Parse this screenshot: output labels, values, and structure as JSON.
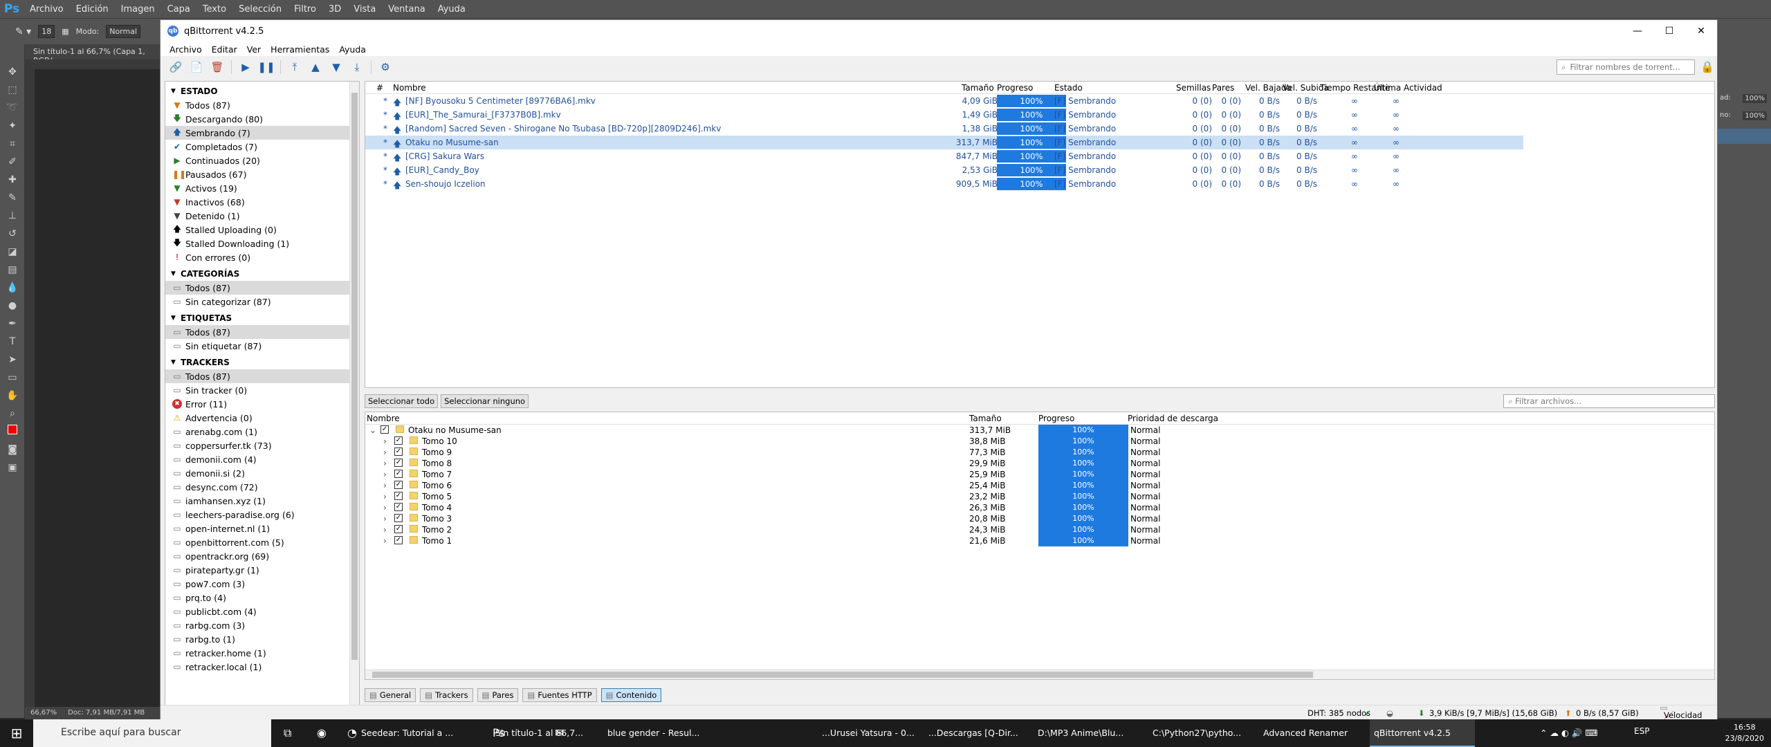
{
  "ps": {
    "menu": [
      "Archivo",
      "Edición",
      "Imagen",
      "Capa",
      "Texto",
      "Selección",
      "Filtro",
      "3D",
      "Vista",
      "Ventana",
      "Ayuda"
    ],
    "brush_size": "18",
    "mode_label": "Modo:",
    "mode_value": "Normal",
    "doc_tab": "Sin título-1 al 66,7% (Capa 1, RGB/",
    "zoom": "66,67%",
    "doc_size": "Doc: 7,91 MB/7,91 MB",
    "right_opacity_label": "ad:",
    "right_opacity": "100%",
    "right_fill_label": "no:",
    "right_fill": "100%"
  },
  "qb": {
    "title": "qBittorrent v4.2.5",
    "menu": [
      "Archivo",
      "Editar",
      "Ver",
      "Herramientas",
      "Ayuda"
    ],
    "search_placeholder": "Filtrar nombres de torrent...",
    "sidebar": {
      "estado_title": "ESTADO",
      "estado": [
        {
          "label": "Todos (87)",
          "icon": "funnel",
          "color": "#d27a1c"
        },
        {
          "label": "Descargando (80)",
          "icon": "down-arrow",
          "color": "#2e7d32"
        },
        {
          "label": "Sembrando (7)",
          "icon": "up-arrow",
          "color": "#1d5fa8",
          "selected": true
        },
        {
          "label": "Completados (7)",
          "icon": "check",
          "color": "#1d5fa8"
        },
        {
          "label": "Continuados (20)",
          "icon": "play",
          "color": "#2e7d32"
        },
        {
          "label": "Pausados (67)",
          "icon": "pause",
          "color": "#d27a1c"
        },
        {
          "label": "Activos (19)",
          "icon": "funnel",
          "color": "#2e7d32"
        },
        {
          "label": "Inactivos (68)",
          "icon": "funnel",
          "color": "#c0392b"
        },
        {
          "label": "Detenido (1)",
          "icon": "funnel",
          "color": "#444"
        },
        {
          "label": "Stalled Uploading (0)",
          "icon": "up-arrow",
          "color": "#000"
        },
        {
          "label": "Stalled Downloading (1)",
          "icon": "down-arrow",
          "color": "#000"
        },
        {
          "label": "Con errores (0)",
          "icon": "exclamation",
          "color": "#c00"
        }
      ],
      "categorias_title": "CATEGORÍAS",
      "categorias": [
        {
          "label": "Todos (87)",
          "selected": true
        },
        {
          "label": "Sin categorizar (87)"
        }
      ],
      "etiquetas_title": "ETIQUETAS",
      "etiquetas": [
        {
          "label": "Todos (87)",
          "selected": true
        },
        {
          "label": "Sin etiquetar (87)"
        }
      ],
      "trackers_title": "TRACKERS",
      "trackers": [
        {
          "label": "Todos (87)",
          "icon": "file",
          "selected": true
        },
        {
          "label": "Sin tracker (0)",
          "icon": "file"
        },
        {
          "label": "Error (11)",
          "icon": "error"
        },
        {
          "label": "Advertencia (0)",
          "icon": "warning"
        },
        {
          "label": "arenabg.com (1)",
          "icon": "file"
        },
        {
          "label": "coppersurfer.tk (73)",
          "icon": "file"
        },
        {
          "label": "demonii.com (4)",
          "icon": "file"
        },
        {
          "label": "demonii.si (2)",
          "icon": "file"
        },
        {
          "label": "desync.com (72)",
          "icon": "file"
        },
        {
          "label": "iamhansen.xyz (1)",
          "icon": "file"
        },
        {
          "label": "leechers-paradise.org (6)",
          "icon": "file"
        },
        {
          "label": "open-internet.nl (1)",
          "icon": "file"
        },
        {
          "label": "openbittorrent.com (5)",
          "icon": "file"
        },
        {
          "label": "opentrackr.org (69)",
          "icon": "file"
        },
        {
          "label": "pirateparty.gr (1)",
          "icon": "file"
        },
        {
          "label": "pow7.com (3)",
          "icon": "file"
        },
        {
          "label": "prq.to (4)",
          "icon": "file"
        },
        {
          "label": "publicbt.com (4)",
          "icon": "file"
        },
        {
          "label": "rarbg.com (3)",
          "icon": "file"
        },
        {
          "label": "rarbg.to (1)",
          "icon": "file"
        },
        {
          "label": "retracker.home (1)",
          "icon": "file"
        },
        {
          "label": "retracker.local (1)",
          "icon": "file"
        }
      ]
    },
    "torrents": {
      "columns": [
        "#",
        "Nombre",
        "Tamaño",
        "Progreso",
        "Estado",
        "Semillas",
        "Pares",
        "Vel. Bajada",
        "Vel. Subida",
        "Tiempo Restante",
        "Última Actividad"
      ],
      "rows": [
        {
          "num": "*",
          "name": "[NF] Byousoku 5 Centimeter [89776BA6].mkv",
          "size": "4,09 GiB",
          "progress": "100%",
          "status": "[F] Sembrando",
          "seeds": "0 (0)",
          "peers": "0 (0)",
          "down": "0 B/s",
          "up": "0 B/s",
          "eta": "∞",
          "last": "∞"
        },
        {
          "num": "*",
          "name": "[EUR]_The_Samurai_[F3737B0B].mkv",
          "size": "1,49 GiB",
          "progress": "100%",
          "status": "[F] Sembrando",
          "seeds": "0 (0)",
          "peers": "0 (0)",
          "down": "0 B/s",
          "up": "0 B/s",
          "eta": "∞",
          "last": "∞"
        },
        {
          "num": "*",
          "name": "[Random] Sacred Seven - Shirogane No Tsubasa  [BD-720p][2809D246].mkv",
          "size": "1,38 GiB",
          "progress": "100%",
          "status": "[F] Sembrando",
          "seeds": "0 (0)",
          "peers": "0 (0)",
          "down": "0 B/s",
          "up": "0 B/s",
          "eta": "∞",
          "last": "∞"
        },
        {
          "num": "*",
          "name": "Otaku no Musume-san",
          "size": "313,7 MiB",
          "progress": "100%",
          "status": "[F] Sembrando",
          "seeds": "0 (0)",
          "peers": "0 (0)",
          "down": "0 B/s",
          "up": "0 B/s",
          "eta": "∞",
          "last": "∞",
          "selected": true
        },
        {
          "num": "*",
          "name": "[CRG] Sakura Wars",
          "size": "847,7 MiB",
          "progress": "100%",
          "status": "[F] Sembrando",
          "seeds": "0 (0)",
          "peers": "0 (0)",
          "down": "0 B/s",
          "up": "0 B/s",
          "eta": "∞",
          "last": "∞"
        },
        {
          "num": "*",
          "name": "[EUR]_Candy_Boy",
          "size": "2,53 GiB",
          "progress": "100%",
          "status": "[F] Sembrando",
          "seeds": "0 (0)",
          "peers": "0 (0)",
          "down": "0 B/s",
          "up": "0 B/s",
          "eta": "∞",
          "last": "∞"
        },
        {
          "num": "*",
          "name": "Sen-shoujo Iczelion",
          "size": "909,5 MiB",
          "progress": "100%",
          "status": "[F] Sembrando",
          "seeds": "0 (0)",
          "peers": "0 (0)",
          "down": "0 B/s",
          "up": "0 B/s",
          "eta": "∞",
          "last": "∞"
        }
      ]
    },
    "select_all": "Seleccionar todo",
    "select_none": "Seleccionar ninguno",
    "file_search_placeholder": "Filtrar archivos...",
    "files": {
      "columns": [
        "Nombre",
        "Tamaño",
        "Progreso",
        "Prioridad de descarga"
      ],
      "root": {
        "name": "Otaku no Musume-san",
        "size": "313,7 MiB",
        "progress": "100%",
        "priority": "Normal"
      },
      "rows": [
        {
          "name": "Tomo 10",
          "size": "38,8 MiB",
          "progress": "100%",
          "priority": "Normal"
        },
        {
          "name": "Tomo 9",
          "size": "77,3 MiB",
          "progress": "100%",
          "priority": "Normal"
        },
        {
          "name": "Tomo 8",
          "size": "29,9 MiB",
          "progress": "100%",
          "priority": "Normal"
        },
        {
          "name": "Tomo 7",
          "size": "25,9 MiB",
          "progress": "100%",
          "priority": "Normal"
        },
        {
          "name": "Tomo 6",
          "size": "25,4 MiB",
          "progress": "100%",
          "priority": "Normal"
        },
        {
          "name": "Tomo 5",
          "size": "23,2 MiB",
          "progress": "100%",
          "priority": "Normal"
        },
        {
          "name": "Tomo 4",
          "size": "26,3 MiB",
          "progress": "100%",
          "priority": "Normal"
        },
        {
          "name": "Tomo 3",
          "size": "20,8 MiB",
          "progress": "100%",
          "priority": "Normal"
        },
        {
          "name": "Tomo 2",
          "size": "24,3 MiB",
          "progress": "100%",
          "priority": "Normal"
        },
        {
          "name": "Tomo 1",
          "size": "21,6 MiB",
          "progress": "100%",
          "priority": "Normal"
        }
      ]
    },
    "tabs": [
      {
        "label": "General"
      },
      {
        "label": "Trackers"
      },
      {
        "label": "Pares"
      },
      {
        "label": "Fuentes HTTP"
      },
      {
        "label": "Contenido",
        "active": true
      }
    ],
    "status": {
      "dht": "DHT: 385 nodos",
      "down": "3,9 KiB/s [9,7 MiB/s] (15,68 GiB)",
      "up": "0 B/s (8,57 GiB)",
      "speed_btn": "Velocidad"
    }
  },
  "taskbar": {
    "search_placeholder": "Escribe aquí para buscar",
    "items": [
      {
        "label": "Seedear: Tutorial a ..."
      },
      {
        "label": "Sin título-1 al 66,7..."
      },
      {
        "label": "blue gender - Resul..."
      },
      {
        "label": "...Urusei Yatsura - 0..."
      },
      {
        "label": "...Descargas [Q-Dir..."
      },
      {
        "label": "D:\\MP3 Anime\\Blu..."
      },
      {
        "label": "C:\\Python27\\pytho..."
      },
      {
        "label": "Advanced Renamer"
      },
      {
        "label": "qBittorrent v4.2.5",
        "active": true
      }
    ],
    "lang": "ESP",
    "time": "16:58",
    "date": "23/8/2020"
  },
  "colors": {
    "accent": "#1f7ae0",
    "link": "#1f4f9f",
    "selection": "#cce0f5"
  }
}
